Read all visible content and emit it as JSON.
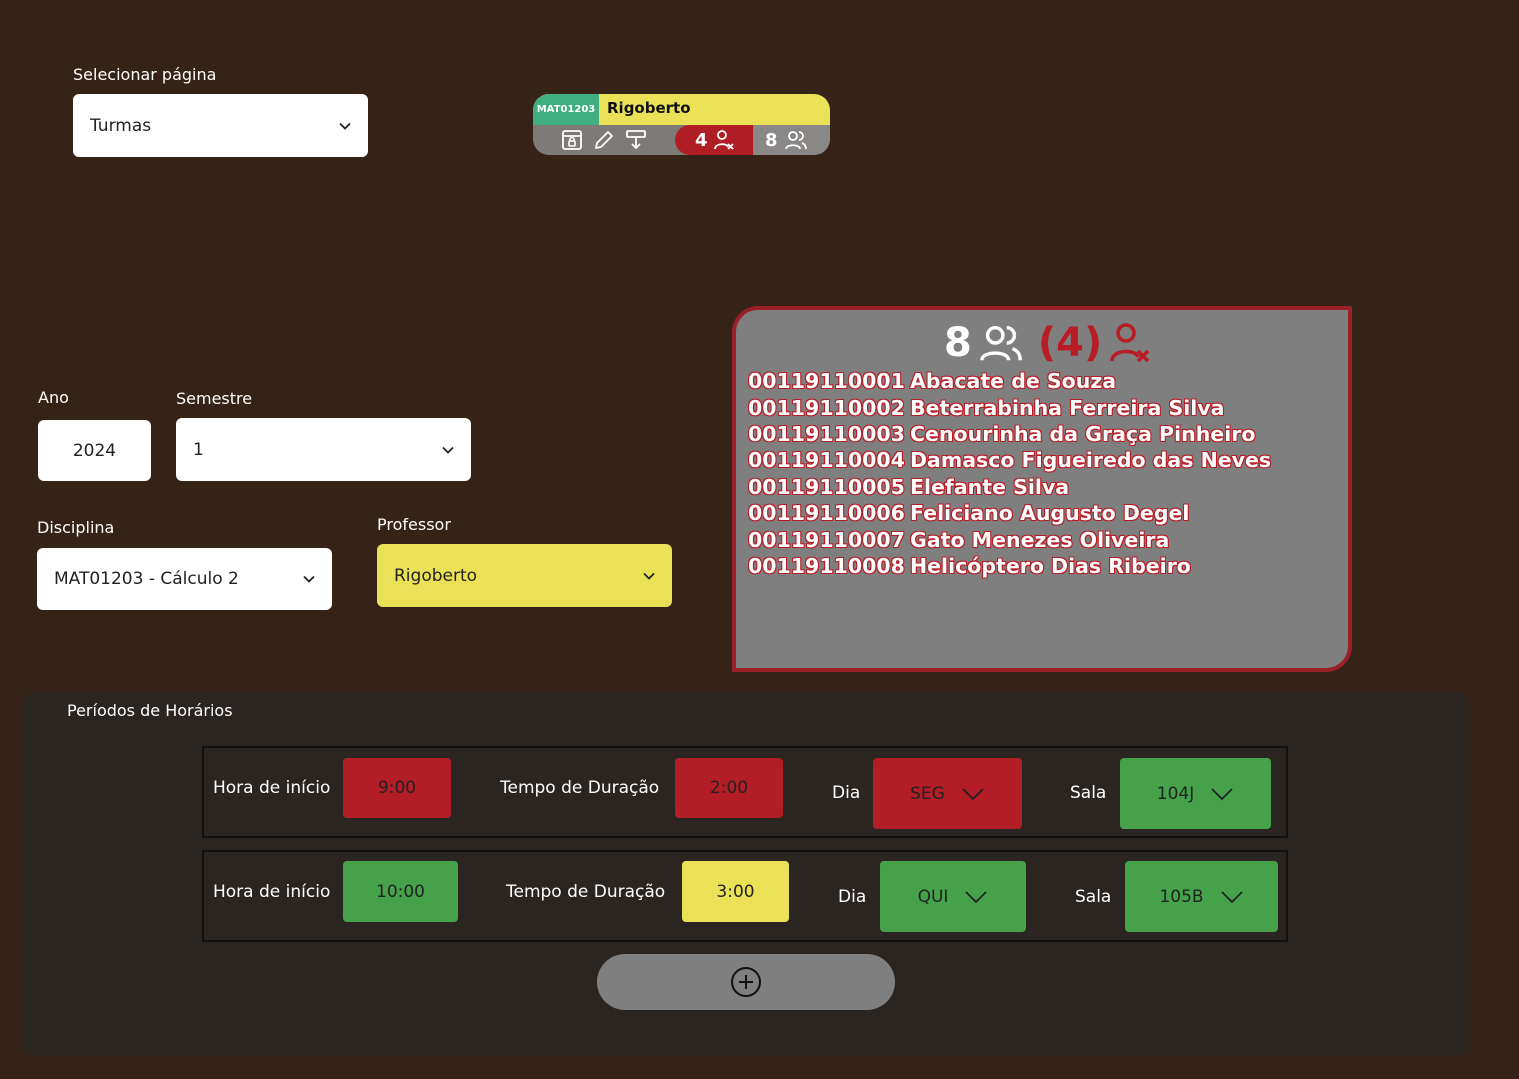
{
  "page_selector": {
    "label": "Selecionar página",
    "value": "Turmas"
  },
  "filters": {
    "ano_label": "Ano",
    "ano_value": "2024",
    "semestre_label": "Semestre",
    "semestre_value": "1",
    "disciplina_label": "Disciplina",
    "disciplina_value": "MAT01203 - Cálculo 2",
    "professor_label": "Professor",
    "professor_value": "Rigoberto"
  },
  "class_card": {
    "code": "MAT01203",
    "professor": "Rigoberto",
    "absent_count": "4",
    "total_count": "8",
    "tools": [
      "lock-calendar-icon",
      "pencil-icon",
      "paint-roller-icon"
    ],
    "colors": {
      "code_bg": "#3fae82",
      "header_bg": "#ebe156",
      "absent_bg": "#b01d24",
      "total_bg": "#8a8887"
    }
  },
  "roster": {
    "total": "8",
    "absent": "(4)",
    "students": [
      {
        "matricula": "00119110001",
        "nome": "Abacate de Souza"
      },
      {
        "matricula": "00119110002",
        "nome": "Beterrabinha Ferreira Silva"
      },
      {
        "matricula": "00119110003",
        "nome": "Cenourinha da Graça Pinheiro"
      },
      {
        "matricula": "00119110004",
        "nome": "Damasco Figueiredo das Neves"
      },
      {
        "matricula": "00119110005",
        "nome": "Elefante Silva"
      },
      {
        "matricula": "00119110006",
        "nome": "Feliciano Augusto Degel"
      },
      {
        "matricula": "00119110007",
        "nome": "Gato Menezes Oliveira"
      },
      {
        "matricula": "00119110008",
        "nome": "Helicóptero Dias Ribeiro"
      }
    ]
  },
  "periods": {
    "title": "Períodos de Horários",
    "rows": [
      {
        "start_label": "Hora de início",
        "start": "9:00",
        "duration_label": "Tempo de Duração",
        "duration": "2:00",
        "day_label": "Dia",
        "day": "SEG",
        "room_label": "Sala",
        "room": "104J",
        "status_colors": {
          "start": "#b31d26",
          "duration": "#b31d26",
          "day": "#b31d26",
          "room": "#46a24a"
        }
      },
      {
        "start_label": "Hora de início",
        "start": "10:00",
        "duration_label": "Tempo de Duração",
        "duration": "3:00",
        "day_label": "Dia",
        "day": "QUI",
        "room_label": "Sala",
        "room": "105B",
        "status_colors": {
          "start": "#46a24a",
          "duration": "#ebe156",
          "day": "#46a24a",
          "room": "#46a24a"
        }
      }
    ],
    "add_icon": "plus-circle-icon"
  }
}
